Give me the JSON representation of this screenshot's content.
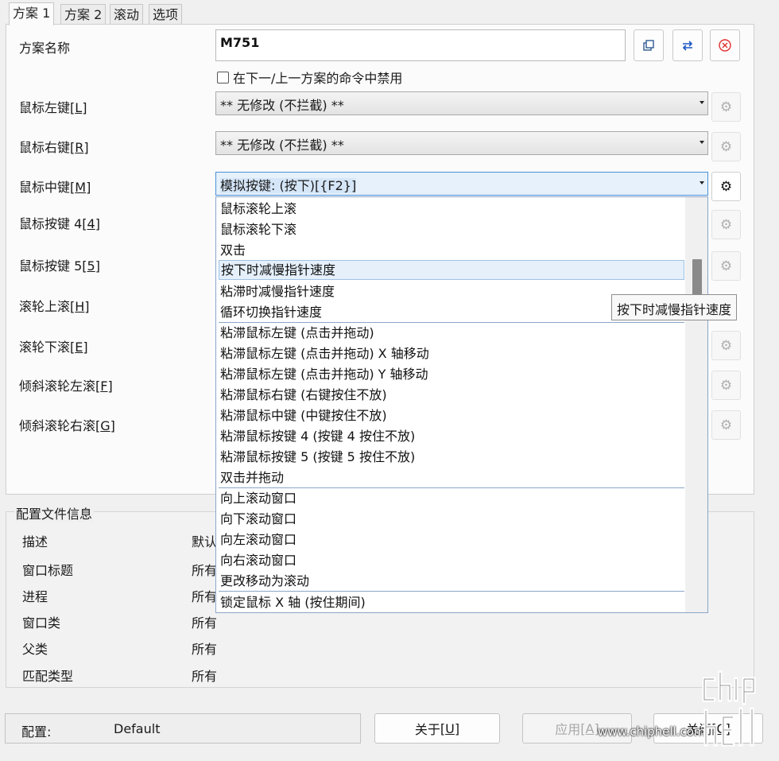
{
  "tabs": [
    "方案 1",
    "方案 2",
    "滚动",
    "选项"
  ],
  "scheme": {
    "name_label": "方案名称",
    "name_value": "M751",
    "disable_checkbox_label": "在下一/上一方案的命令中禁用",
    "disable_checkbox_checked": false
  },
  "buttons": {
    "copy_icon": "copy-icon",
    "swap_icon": "swap-arrows-icon",
    "delete_icon": "close-circle-icon"
  },
  "mappings": [
    {
      "label": "鼠标左键",
      "key": "L",
      "value": "** 无修改 (不拦截) **"
    },
    {
      "label": "鼠标右键",
      "key": "R",
      "value": "** 无修改 (不拦截) **"
    },
    {
      "label": "鼠标中键",
      "key": "M",
      "value": "模拟按键: (按下)[{F2}]"
    },
    {
      "label": "鼠标按键 4",
      "key": "4"
    },
    {
      "label": "鼠标按键 5",
      "key": "5"
    },
    {
      "label": "滚轮上滚",
      "key": "H"
    },
    {
      "label": "滚轮下滚",
      "key": "E"
    },
    {
      "label": "倾斜滚轮左滚",
      "key": "F"
    },
    {
      "label": "倾斜滚轮右滚",
      "key": "G"
    }
  ],
  "dropdown": {
    "items": [
      "鼠标滚轮上滚",
      "鼠标滚轮下滚",
      "双击",
      "按下时减慢指针速度",
      "粘滞时减慢指针速度",
      "循环切换指针速度",
      "粘滞鼠标左键 (点击并拖动)",
      "粘滞鼠标左键 (点击并拖动) X 轴移动",
      "粘滞鼠标左键 (点击并拖动) Y 轴移动",
      "粘滞鼠标右键 (右键按住不放)",
      "粘滞鼠标中键 (中键按住不放)",
      "粘滞鼠标按键 4 (按键 4 按住不放)",
      "粘滞鼠标按键 5 (按键 5 按住不放)",
      "双击并拖动",
      "向上滚动窗口",
      "向下滚动窗口",
      "向左滚动窗口",
      "向右滚动窗口",
      "更改移动为滚动",
      "锁定鼠标 X 轴 (按住期间)"
    ],
    "highlighted": "按下时减慢指针速度"
  },
  "tooltip": "按下时减慢指针速度",
  "profile_info": {
    "title": "配置文件信息",
    "rows": [
      {
        "key": "描述",
        "value": "默认"
      },
      {
        "key": "窗口标题",
        "value": "所有"
      },
      {
        "key": "进程",
        "value": "所有"
      },
      {
        "key": "窗口类",
        "value": "所有"
      },
      {
        "key": "父类",
        "value": "所有"
      },
      {
        "key": "匹配类型",
        "value": "所有"
      }
    ]
  },
  "status": {
    "label": "配置:",
    "value": "Default"
  },
  "bottom_buttons": {
    "about": "关于",
    "about_key": "U",
    "apply": "应用",
    "apply_key": "A",
    "close": "关闭",
    "close_key": "C"
  },
  "watermark": {
    "url": "www.chiphell.com",
    "logo": "chip hell"
  }
}
